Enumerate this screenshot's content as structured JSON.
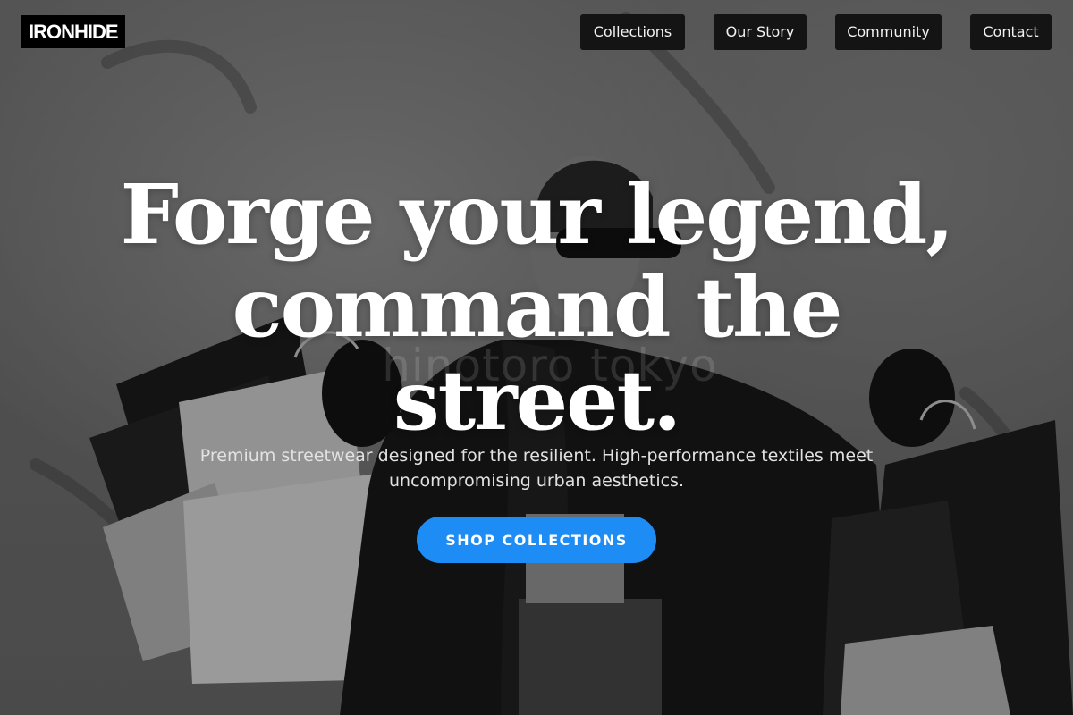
{
  "brand": {
    "logo_text": "IRONHIDE"
  },
  "nav": {
    "items": [
      {
        "label": "Collections"
      },
      {
        "label": "Our Story"
      },
      {
        "label": "Community"
      },
      {
        "label": "Contact"
      }
    ]
  },
  "hero": {
    "headline_line1": "Forge your legend,",
    "headline_line2": "command the",
    "headline_line3": "street.",
    "subtext_line1": "Premium streetwear designed for the resilient. High-performance textiles meet",
    "subtext_line2": "uncompromising urban aesthetics.",
    "cta_label": "SHOP COLLECTIONS",
    "watermark_text": "hinotoro tokyo",
    "image_subject": "grayscale photo of woman in sunglasses and black jacket holding shopping bags"
  },
  "colors": {
    "accent": "#1e8cf5",
    "nav_bg": "#141414",
    "logo_bg": "#000000",
    "text": "#ffffff"
  }
}
